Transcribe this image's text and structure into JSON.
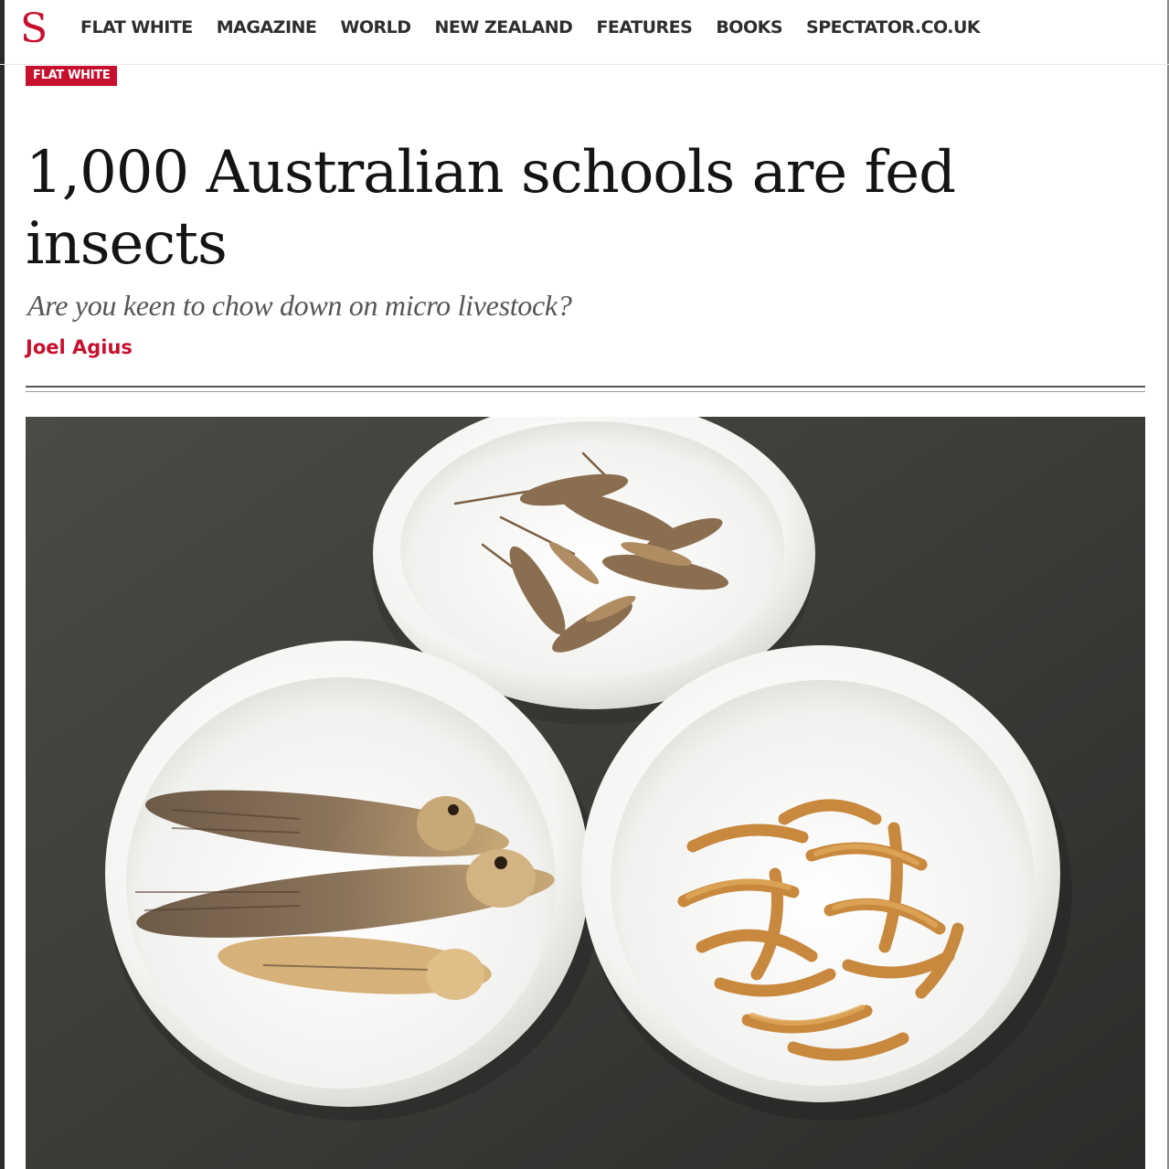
{
  "nav": {
    "logo": "S",
    "items": [
      "FLAT WHITE",
      "MAGAZINE",
      "WORLD",
      "NEW ZEALAND",
      "FEATURES",
      "BOOKS",
      "SPECTATOR.CO.UK"
    ]
  },
  "article": {
    "section": "FLAT WHITE",
    "title": "1,000 Australian schools are fed insects",
    "standfirst": "Are you keen to chow down on micro livestock?",
    "author": "Joel Agius"
  },
  "colors": {
    "brand": "#c8102e",
    "text": "#141414"
  }
}
